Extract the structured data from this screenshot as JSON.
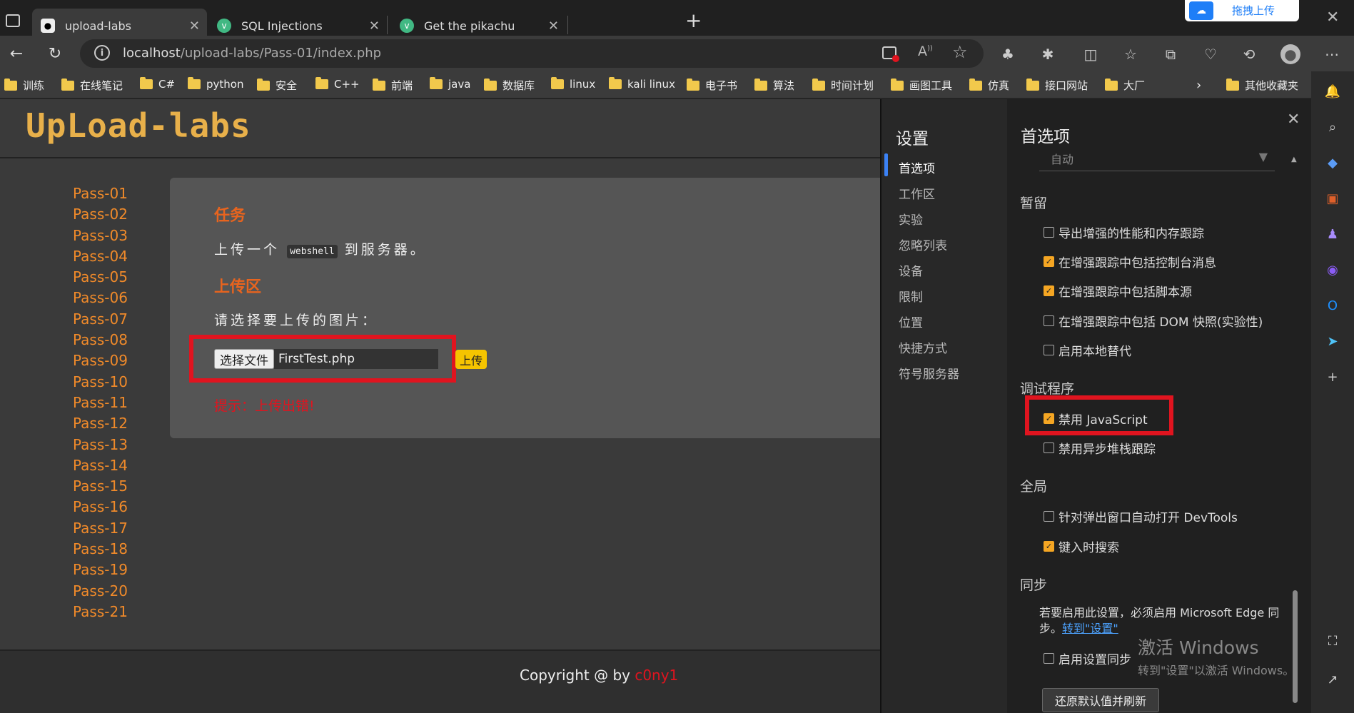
{
  "tabs": [
    {
      "title": "upload-labs",
      "active": true
    },
    {
      "title": "SQL Injections",
      "active": false
    },
    {
      "title": "Get the pikachu",
      "active": false
    }
  ],
  "baidu_upload": {
    "label": "拖拽上传"
  },
  "address": {
    "host": "localhost",
    "path": "/upload-labs/Pass-01/index.php"
  },
  "bookmarks": [
    "训练",
    "在线笔记",
    "C#",
    "python",
    "安全",
    "C++",
    "前端",
    "java",
    "数据库",
    "linux",
    "kali linux",
    "电子书",
    "算法",
    "时间计划",
    "画图工具",
    "仿真",
    "接口网站",
    "大厂"
  ],
  "other_bookmarks": "其他收藏夹",
  "page": {
    "logo": "UpLoad-labs",
    "passes": [
      "Pass-01",
      "Pass-02",
      "Pass-03",
      "Pass-04",
      "Pass-05",
      "Pass-06",
      "Pass-07",
      "Pass-08",
      "Pass-09",
      "Pass-10",
      "Pass-11",
      "Pass-12",
      "Pass-13",
      "Pass-14",
      "Pass-15",
      "Pass-16",
      "Pass-17",
      "Pass-18",
      "Pass-19",
      "Pass-20",
      "Pass-21"
    ],
    "task_heading": "任务",
    "task_pre": "上传一个",
    "task_code": "webshell",
    "task_post": "到服务器。",
    "upload_heading": "上传区",
    "choose_prompt": "请选择要上传的图片：",
    "choose_file_button": "选择文件",
    "file_name": "FirstTest.php",
    "upload_button": "上传",
    "message": "提示：上传出错!",
    "copyright": "Copyright @  by ",
    "author": "c0ny1"
  },
  "devtools": {
    "settings_title": "设置",
    "nav": [
      "首选项",
      "工作区",
      "实验",
      "忽略列表",
      "设备",
      "限制",
      "位置",
      "快捷方式",
      "符号服务器"
    ],
    "pref_title": "首选项",
    "auto_select": "自动",
    "sections": {
      "persist": "暂留",
      "debugger": "调试程序",
      "global": "全局",
      "sync": "同步"
    },
    "options": [
      {
        "label": "导出增强的性能和内存跟踪",
        "checked": false
      },
      {
        "label": "在增强跟踪中包括控制台消息",
        "checked": true
      },
      {
        "label": "在增强跟踪中包括脚本源",
        "checked": true
      },
      {
        "label": "在增强跟踪中包括 DOM 快照(实验性)",
        "checked": false
      },
      {
        "label": "启用本地替代",
        "checked": false
      },
      {
        "label": "禁用 JavaScript",
        "checked": true
      },
      {
        "label": "禁用异步堆栈跟踪",
        "checked": false
      },
      {
        "label": "针对弹出窗口自动打开 DevTools",
        "checked": false
      },
      {
        "label": "键入时搜索",
        "checked": true
      },
      {
        "label": "启用设置同步",
        "checked": false
      }
    ],
    "sync_text_1": "若要启用此设置，必须启用 Microsoft Edge 同",
    "sync_text_2": "步。",
    "sync_link": "转到\"设置\"",
    "restore_button": "还原默认值并刷新"
  },
  "watermark": {
    "line1": "激活 Windows",
    "line2": "转到\"设置\"以激活 Windows。"
  },
  "colors": {
    "accent_orange": "#f08a2a",
    "highlight_red": "#e0141f",
    "upload_yellow": "#f5c400",
    "checkbox_orange": "#f5a623"
  }
}
